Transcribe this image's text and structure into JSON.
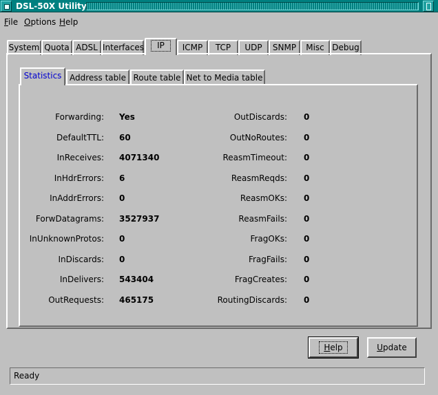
{
  "window": {
    "title": "DSL-50X Utility"
  },
  "menu": {
    "file": {
      "mnemonic": "F",
      "rest": "ile"
    },
    "options": {
      "mnemonic": "O",
      "rest": "ptions"
    },
    "help": {
      "mnemonic": "H",
      "rest": "elp"
    }
  },
  "tabs": [
    "System",
    "Quota",
    "ADSL",
    "Interfaces",
    "IP",
    "ICMP",
    "TCP",
    "UDP",
    "SNMP",
    "Misc",
    "Debug"
  ],
  "active_tab": "IP",
  "subtabs": [
    "Statistics",
    "Address table",
    "Route table",
    "Net to Media table"
  ],
  "active_subtab": "Statistics",
  "stats_left": [
    {
      "label": "Forwarding:",
      "value": "Yes"
    },
    {
      "label": "DefaultTTL:",
      "value": "60"
    },
    {
      "label": "InReceives:",
      "value": "4071340"
    },
    {
      "label": "InHdrErrors:",
      "value": "6"
    },
    {
      "label": "InAddrErrors:",
      "value": "0"
    },
    {
      "label": "ForwDatagrams:",
      "value": "3527937"
    },
    {
      "label": "InUnknownProtos:",
      "value": "0"
    },
    {
      "label": "InDiscards:",
      "value": "0"
    },
    {
      "label": "InDelivers:",
      "value": "543404"
    },
    {
      "label": "OutRequests:",
      "value": "465175"
    }
  ],
  "stats_right": [
    {
      "label": "OutDiscards:",
      "value": "0"
    },
    {
      "label": "OutNoRoutes:",
      "value": "0"
    },
    {
      "label": "ReasmTimeout:",
      "value": "0"
    },
    {
      "label": "ReasmReqds:",
      "value": "0"
    },
    {
      "label": "ReasmOKs:",
      "value": "0"
    },
    {
      "label": "ReasmFails:",
      "value": "0"
    },
    {
      "label": "FragOKs:",
      "value": "0"
    },
    {
      "label": "FragFails:",
      "value": "0"
    },
    {
      "label": "FragCreates:",
      "value": "0"
    },
    {
      "label": "RoutingDiscards:",
      "value": "0"
    }
  ],
  "buttons": {
    "help": {
      "mnemonic": "H",
      "rest": "elp"
    },
    "update": {
      "mnemonic": "U",
      "rest": "pdate"
    }
  },
  "status": "Ready",
  "colors": {
    "titlebar": "#008080",
    "background": "#c0c0c0",
    "active_subtab_text": "#0000d0"
  }
}
